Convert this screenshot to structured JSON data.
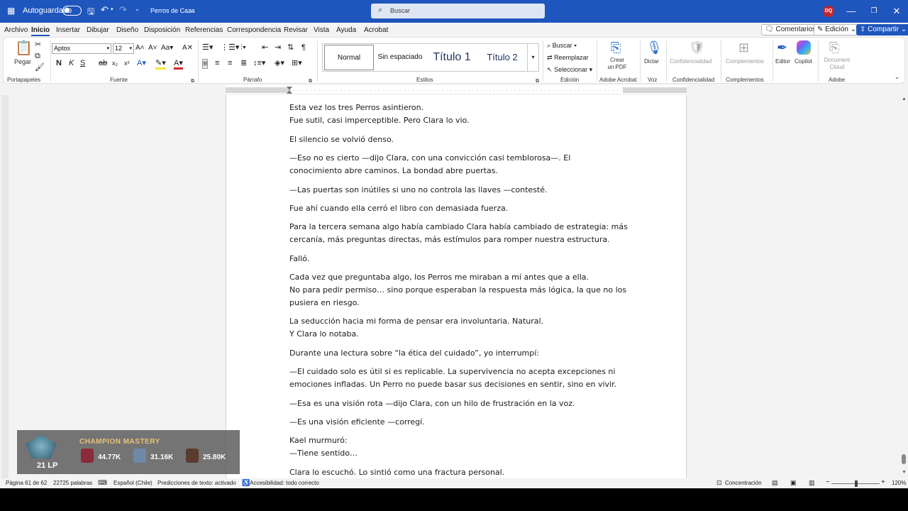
{
  "titlebar": {
    "autosave_label": "Autoguardado",
    "doc_name": "Perros de Caza",
    "search_placeholder": "Buscar",
    "avatar_initials": "DQ"
  },
  "menu": {
    "items": [
      "Archivo",
      "Inicio",
      "Insertar",
      "Dibujar",
      "Diseño",
      "Disposición",
      "Referencias",
      "Correspondencia",
      "Revisar",
      "Vista",
      "Ayuda",
      "Acrobat"
    ],
    "active": "Inicio",
    "comments_label": "Comentarios",
    "edit_mode_label": "Edición",
    "share_label": "Compartir"
  },
  "ribbon": {
    "paste_label": "Pegar",
    "font_name": "Aptos",
    "font_size": "12",
    "styles": [
      "Normal",
      "Sin espaciado",
      "Título 1",
      "Título 2"
    ],
    "find_label": "Buscar",
    "replace_label": "Reemplazar",
    "select_label": "Seleccionar",
    "create_pdf_label": "Crear un PDF",
    "dictate_label": "Dictar",
    "confidentiality_label": "Confidencialidad",
    "complements_label": "Complementos",
    "editor_label": "Editor",
    "copilot_label": "Copilot",
    "document_cloud_label": "Document Cloud",
    "groups": {
      "clipboard": "Portapapeles",
      "font": "Fuente",
      "paragraph": "Párrafo",
      "styles": "Estilos",
      "editing": "Edición",
      "adobe_acrobat": "Adobe Acrobat",
      "voice": "Voz",
      "confidentiality": "Confidencialidad",
      "complements": "Complementos",
      "adobe": "Adobe"
    }
  },
  "document": {
    "lines": [
      "Esta vez los tres Perros asintieron.",
      "Fue sutil, casi imperceptible. Pero Clara lo vio.",
      "El silencio se volvió denso.",
      "—Eso no es cierto —dijo Clara, con una convicción casi temblorosa—. El",
      "conocimiento abre caminos. La bondad abre puertas.",
      "—Las puertas son inútiles si uno no controla las llaves —contesté.",
      "Fue ahí cuando ella cerró el libro con demasiada fuerza.",
      "Para la tercera semana algo había cambiado Clara había cambiado de estrategia: más",
      "cercanía, más preguntas directas, más estímulos para romper nuestra estructura.",
      "Falló.",
      "Cada vez que preguntaba algo, los Perros me miraban a mí antes que a ella.",
      "No para pedir permiso… sino porque esperaban la respuesta más lógica, la que no los",
      "pusiera en riesgo.",
      "La seducción hacia mi forma de pensar era involuntaria. Natural.",
      "Y Clara lo notaba.",
      "Durante una lectura sobre “la ética del cuidado”, yo interrumpí:",
      "—El cuidado solo es útil si es replicable. La supervivencia no acepta excepciones ni",
      "emociones infladas. Un Perro no puede basar sus decisiones en sentir, sino en vivir.",
      "—Esa es una visión rota —dijo Clara, con un hilo de frustración en la voz.",
      "—Es una visión eficiente —corregí.",
      "Kael murmuró:",
      "—Tiene sentido…",
      "Clara lo escuchó. Lo sintió como una fractura personal."
    ]
  },
  "status": {
    "page": "Página 61 de 62",
    "words": "22725 palabras",
    "language": "Español (Chile)",
    "text_predictions": "Predicciones de texto: activado",
    "accessibility": "Accesibilidad: todo correcto",
    "focus": "Concentración",
    "zoom": "120%"
  },
  "overlay": {
    "title": "CHAMPION MASTERY",
    "lp": "21 LP",
    "values": [
      "44.77K",
      "31.16K",
      "25.80K"
    ]
  },
  "colors": {
    "titlebar": "#1f56bd",
    "accent": "#1f56bd",
    "avatar": "#c4262e"
  }
}
